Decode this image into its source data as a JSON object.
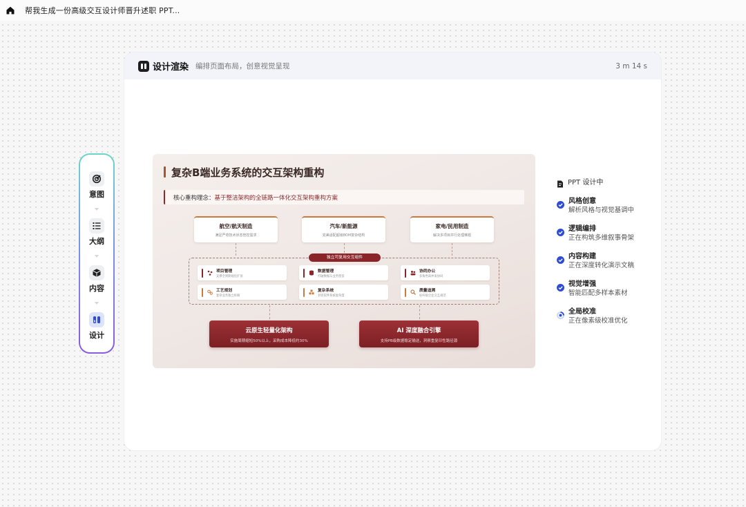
{
  "topbar": {
    "title": "帮我生成一份高级交互设计师晋升述职 PPT..."
  },
  "rail": {
    "items": [
      {
        "label": "意图",
        "icon": "target-icon"
      },
      {
        "label": "大纲",
        "icon": "list-icon"
      },
      {
        "label": "内容",
        "icon": "box-icon"
      },
      {
        "label": "设计",
        "icon": "design-icon"
      }
    ],
    "active": "设计"
  },
  "panel": {
    "title": "设计渲染",
    "subtitle": "编排页面布局，创意视觉呈现",
    "timer": "3 m 14 s"
  },
  "slide": {
    "title": "复杂B端业务系统的交互架构重构",
    "core_label": "核心重构理念：",
    "core_text": "基于整洁架构的全链路一体化交互架构重构方案",
    "industries": [
      {
        "title": "航空/航天制造",
        "desc": "满足严苛技术状态管控需求"
      },
      {
        "title": "汽车/新能源",
        "desc": "完美适配超级BOM复杂结构"
      },
      {
        "title": "家电/民用制造",
        "desc": "解决多项目并行处理难题"
      }
    ],
    "component_tag": "独立可复用交互组件",
    "modules": [
      {
        "name": "项目管理",
        "desc": "支撑全周期规化扩张"
      },
      {
        "name": "数据管理",
        "desc": "打破数据与业务壁垒"
      },
      {
        "name": "协同办公",
        "desc": "多角色高并发协同"
      },
      {
        "name": "工艺规划",
        "desc": "复杂业务独立拆解"
      },
      {
        "name": "复杂系统",
        "desc": "封装软件系统复杂度"
      },
      {
        "name": "质量追溯",
        "desc": "标杆级企业交互规范"
      }
    ],
    "tech": [
      {
        "title": "云原生轻量化架构",
        "desc": "实施周期缩短50%以上，采购成本降低约30%"
      },
      {
        "title": "AI 深度融合引擎",
        "desc": "支持PB级数据稳定输送，洞察重复印性路径源"
      }
    ]
  },
  "status": {
    "label": "PPT 设计中",
    "steps": [
      {
        "title": "风格创意",
        "desc": "解析风格与视觉基调中",
        "state": "done"
      },
      {
        "title": "逻辑编排",
        "desc": "正在构筑多维叙事骨架",
        "state": "done"
      },
      {
        "title": "内容构建",
        "desc": "正在深度转化演示文稿",
        "state": "done"
      },
      {
        "title": "视觉增强",
        "desc": "智能匹配多样本素材",
        "state": "done"
      },
      {
        "title": "全局校准",
        "desc": "正在像素级校准优化",
        "state": "active"
      }
    ]
  },
  "colors": {
    "accent": "#2f4bd6",
    "slide_red": "#8a2428",
    "slide_orange": "#c87a3f"
  }
}
